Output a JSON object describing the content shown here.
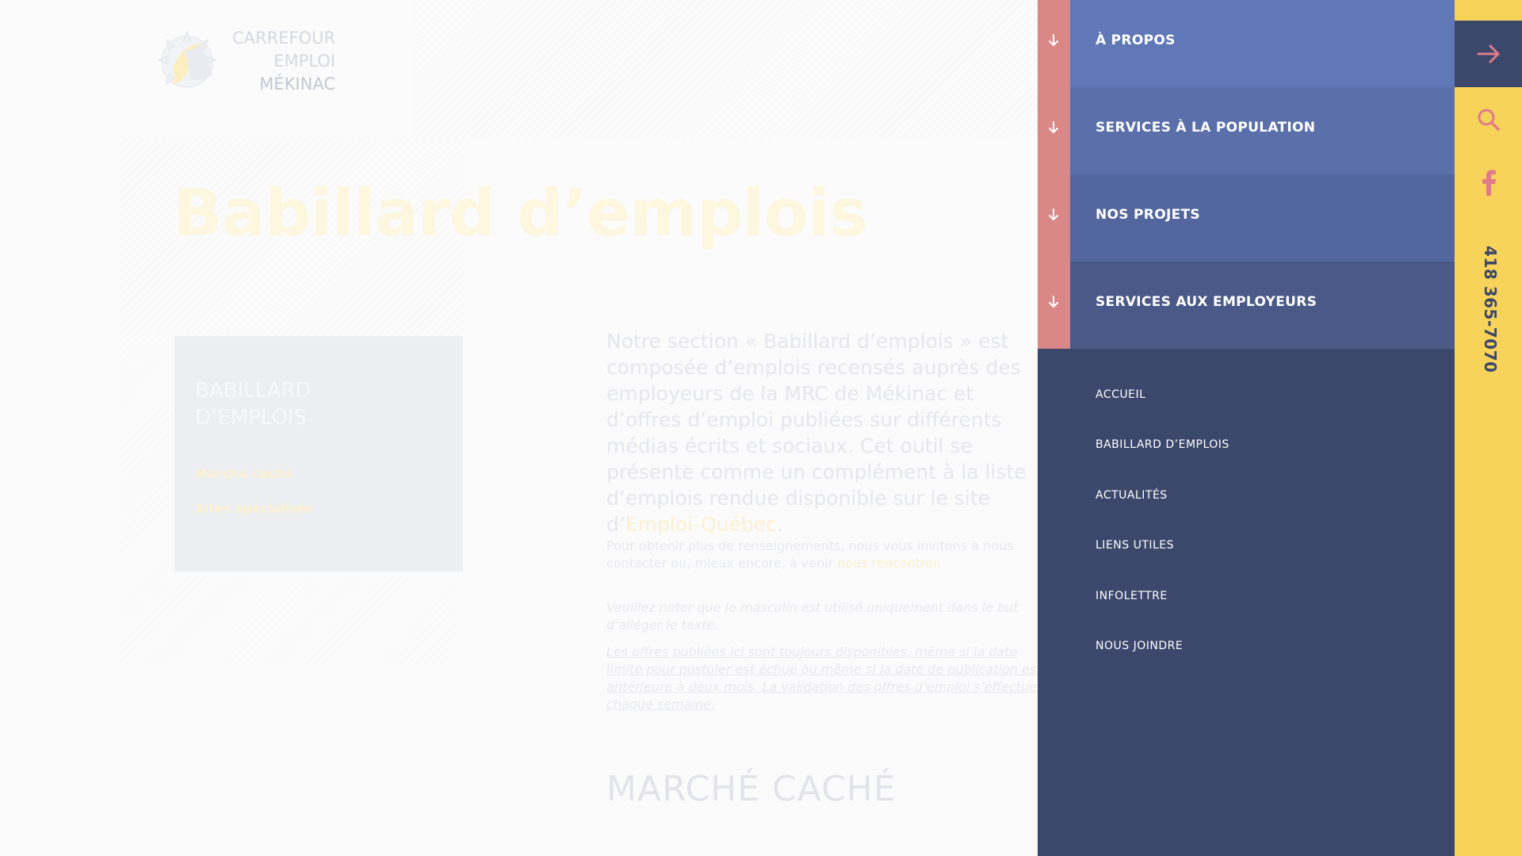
{
  "brand": {
    "logo_lines": [
      "CARREFOUR",
      "EMPLOI",
      "MÉKINAC"
    ]
  },
  "page": {
    "title": "Babillard d’emplois",
    "sidebar": {
      "title_lines": [
        "BABILLARD",
        "D’EMPLOIS"
      ],
      "links": [
        "Marché caché",
        "Sites spécialisés"
      ]
    },
    "intro_before_link": "Notre section « Babillard d’emplois » est composée d’emplois recensés auprès des employeurs de la MRC de Mékinac et d’offres d’emploi publiées sur différents médias écrits et sociaux. Cet outil se présente comme un complément à la liste d’emplois rendue disponible sur le site d’",
    "intro_link": "Emploi-Québec",
    "intro_after_link": ".",
    "contact_before_link": "Pour obtenir plus de renseignements, nous vous invitons à nous contacter ou, mieux encore, à venir ",
    "contact_link": "nous rencontrer",
    "contact_after_link": ".",
    "note_gender": "Veuillez noter que le masculin est utilisé uniquement dans le but d’alléger le texte.",
    "note_offers": "Les offres publiées ici sont toujours disponibles, même si la date limite pour postuler est échue ou même si la date de publication est antérieure à deux mois. La validation des offres d’emploi s’effectue chaque semaine.",
    "section_title": "MARCHÉ CACHÉ"
  },
  "menu": {
    "main_items": [
      {
        "label": "À PROPOS"
      },
      {
        "label": "SERVICES À LA POPULATION"
      },
      {
        "label": "NOS PROJETS"
      },
      {
        "label": "SERVICES AUX EMPLOYEURS"
      }
    ],
    "sub_items": [
      {
        "label": "ACCUEIL"
      },
      {
        "label": "BABILLARD D’EMPLOIS"
      },
      {
        "label": "ACTUALITÉS"
      },
      {
        "label": "LIENS UTILES"
      },
      {
        "label": "INFOLETTRE"
      },
      {
        "label": "NOUS JOINDRE"
      }
    ],
    "icons": {
      "expand": "arrow-down-icon",
      "close": "arrow-right-icon",
      "search": "search-icon",
      "facebook": "facebook-icon"
    }
  },
  "rail": {
    "phone": "418 365-7070"
  },
  "colors": {
    "menu_bg": "#3c476c",
    "menu_item_1": "#6077b8",
    "menu_item_2": "#5b70ab",
    "menu_item_3": "#53669d",
    "menu_item_4": "#4a5987",
    "expand_strip": "#d98787",
    "rail": "#f7d359",
    "accent_pink": "#e07b8a"
  }
}
